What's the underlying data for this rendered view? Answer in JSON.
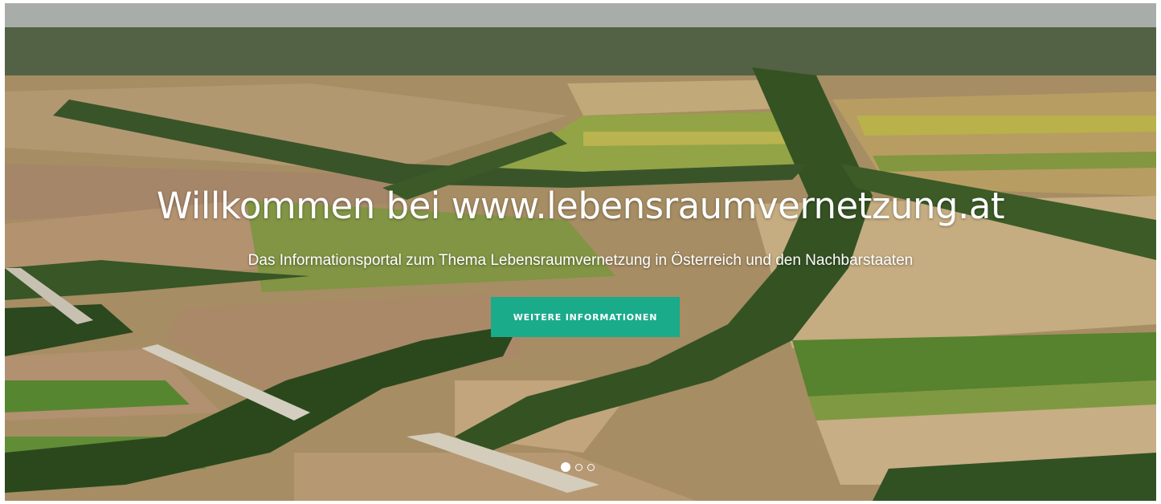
{
  "hero": {
    "title": "Willkommen bei www.lebensraumvernetzung.at",
    "subtitle": "Das Informationsportal zum Thema Lebensraumvernetzung in Österreich und den Nachbarstaaten",
    "cta_label": "WEITERE INFORMATIONEN",
    "background_image": "aerial view of agricultural fields and hedgerows",
    "slides": [
      {
        "label": "slide 1",
        "active": true
      },
      {
        "label": "slide 2",
        "active": false
      },
      {
        "label": "slide 3",
        "active": false
      }
    ]
  },
  "colors": {
    "accent": "#1aab8b",
    "text": "#ffffff"
  }
}
